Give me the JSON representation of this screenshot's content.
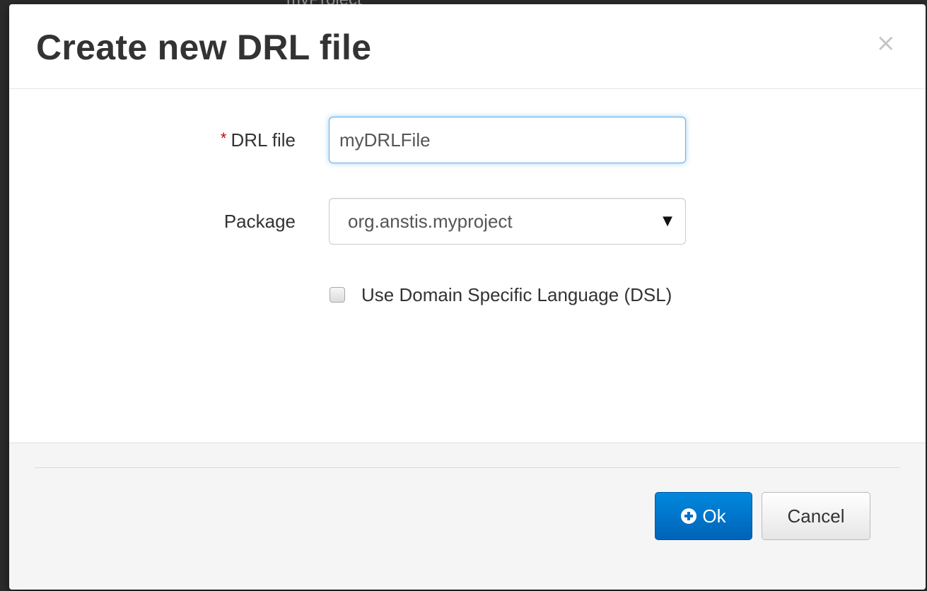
{
  "background": {
    "partial_text": "myProject"
  },
  "dialog": {
    "title": "Create new DRL file",
    "close_symbol": "×",
    "close_icon": "close-icon"
  },
  "form": {
    "drl_file": {
      "required_marker": "*",
      "label": "DRL file",
      "value": "myDRLFile"
    },
    "package": {
      "label": "Package",
      "selected": "org.anstis.myproject",
      "caret": "▼"
    },
    "dsl": {
      "label": "Use Domain Specific Language (DSL)",
      "checked": false
    }
  },
  "footer": {
    "ok_label": "Ok",
    "ok_icon": "plus-circle-icon",
    "cancel_label": "Cancel"
  },
  "colors": {
    "primary": "#0070c8",
    "required": "#cc0000",
    "focus_border": "#66afe9"
  }
}
